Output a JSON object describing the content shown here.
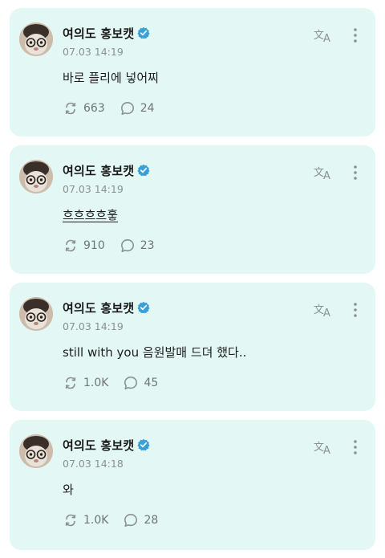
{
  "colors": {
    "card_background": "#e3f8f4",
    "verified_badge": "#3aa0d8",
    "icon_gray": "#8b9094"
  },
  "posts": [
    {
      "author": "여의도 홍보캣",
      "verified_icon": "verified-badge-icon",
      "timestamp": "07.03 14:19",
      "text": "바로 플리에 넣어찌",
      "underlined": false,
      "reposts": "663",
      "replies": "24"
    },
    {
      "author": "여의도 홍보캣",
      "verified_icon": "verified-badge-icon",
      "timestamp": "07.03 14:19",
      "text": "흐흐흐흐훟",
      "underlined": true,
      "reposts": "910",
      "replies": "23"
    },
    {
      "author": "여의도 홍보캣",
      "verified_icon": "verified-badge-icon",
      "timestamp": "07.03 14:19",
      "text": "still with you 음원발매 드뎌 했다..",
      "underlined": false,
      "reposts": "1.0K",
      "replies": "45"
    },
    {
      "author": "여의도 홍보캣",
      "verified_icon": "verified-badge-icon",
      "timestamp": "07.03 14:18",
      "text": "와",
      "underlined": false,
      "reposts": "1.0K",
      "replies": "28"
    }
  ],
  "icons": {
    "repost": "repost-icon",
    "reply": "reply-bubble-icon",
    "translate": "translate-icon",
    "more": "more-vertical-icon"
  }
}
